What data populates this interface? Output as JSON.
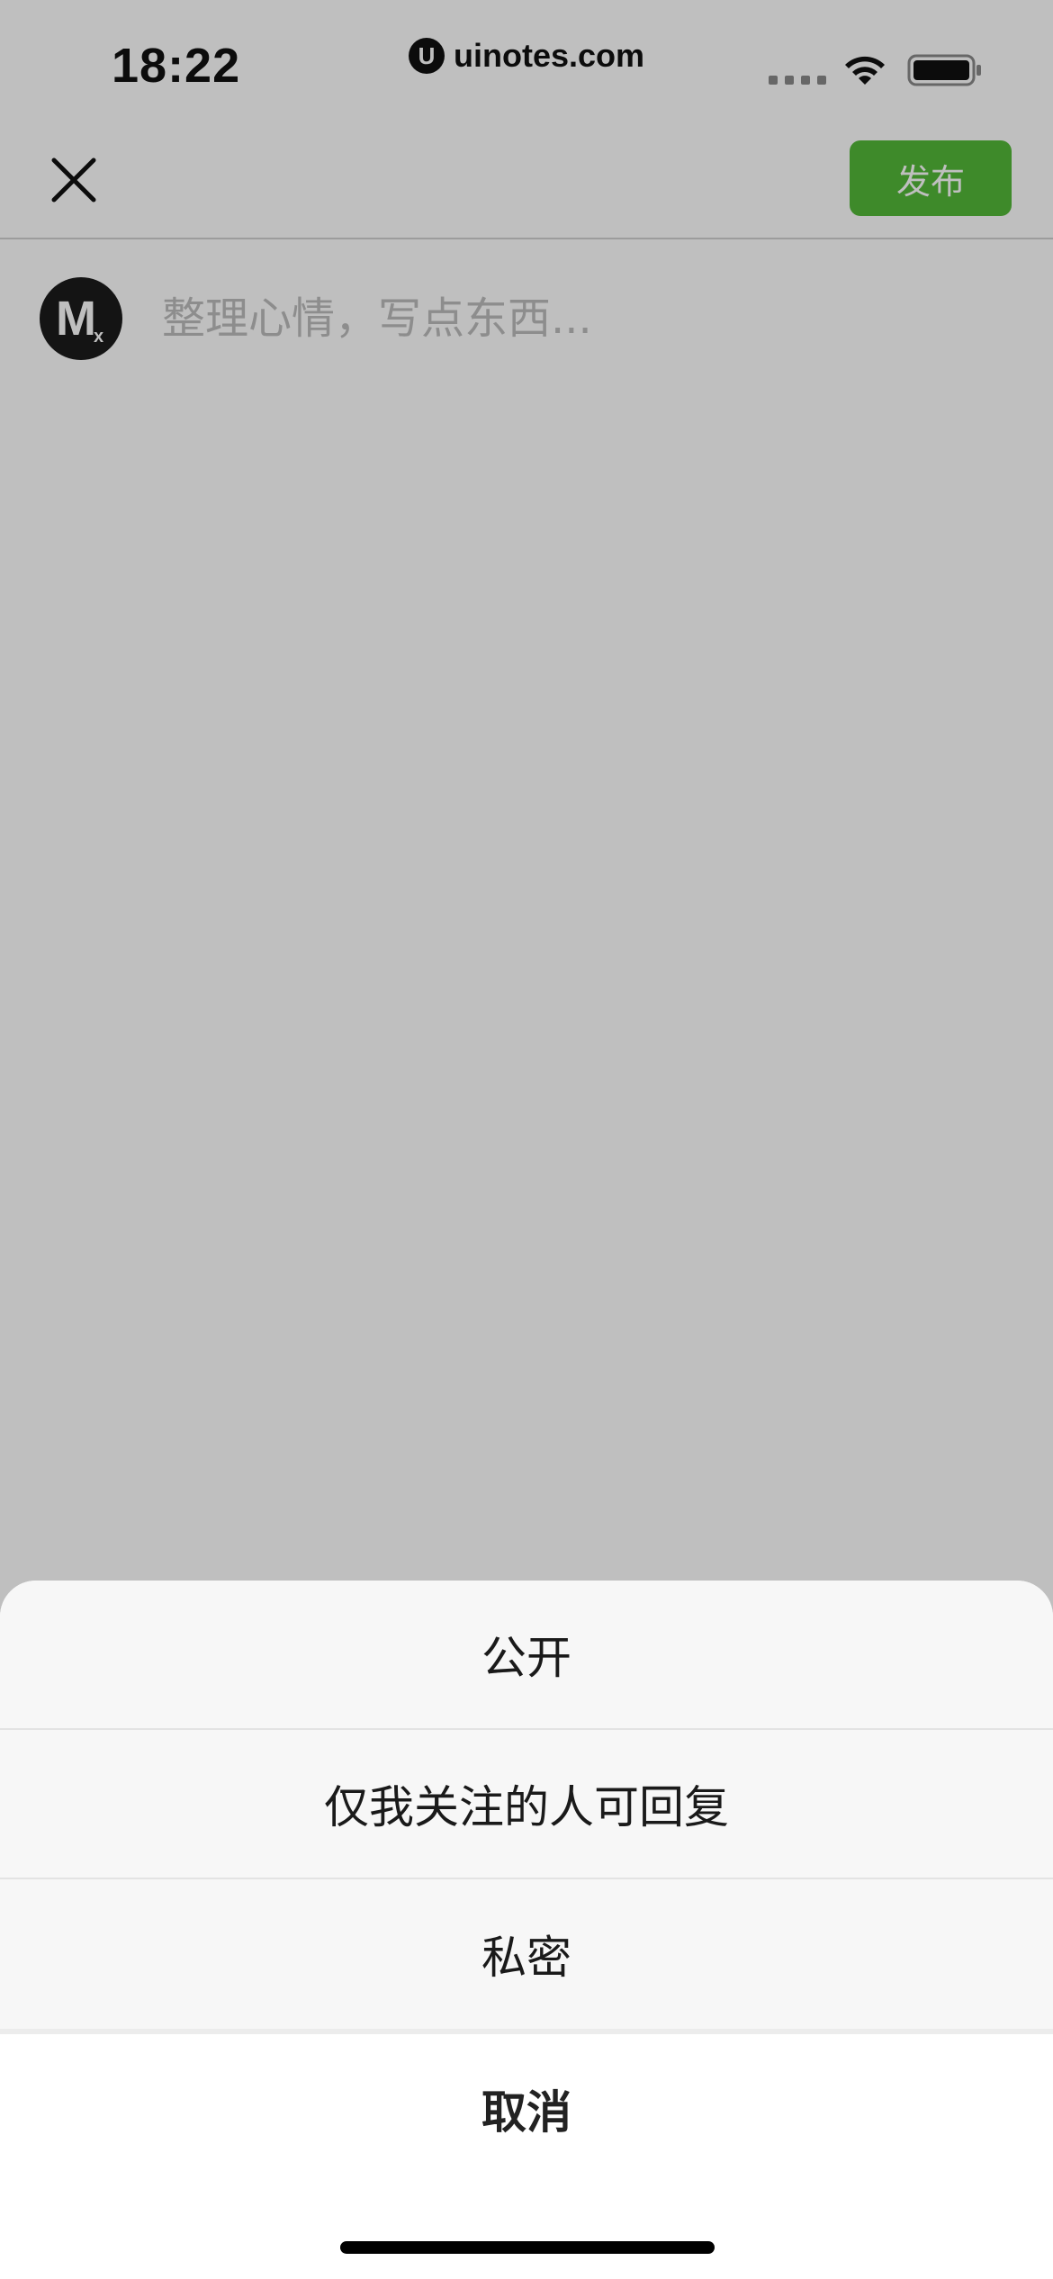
{
  "status_bar": {
    "time": "18:22",
    "watermark": "uinotes.com",
    "watermark_logo": "U"
  },
  "nav": {
    "close_icon": "close-icon",
    "publish_label": "发布"
  },
  "composer": {
    "avatar_letter": "M",
    "avatar_subscript": "x",
    "placeholder": "整理心情，写点东西..."
  },
  "action_sheet": {
    "options": [
      {
        "label": "公开"
      },
      {
        "label": "仅我关注的人可回复"
      },
      {
        "label": "私密"
      }
    ],
    "cancel_label": "取消"
  },
  "colors": {
    "publish_button": "#53b838",
    "overlay": "rgba(0,0,0,0.25)",
    "sheet_bg": "#f7f7f7"
  }
}
